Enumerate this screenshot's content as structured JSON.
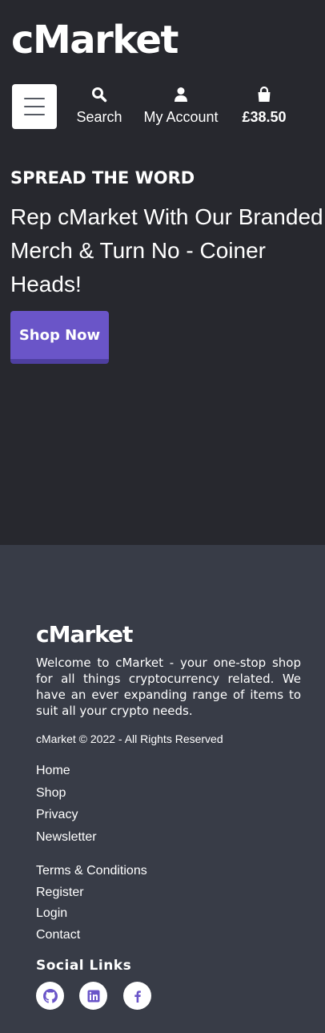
{
  "header": {
    "logo": "cMarket",
    "menu_icon": "hamburger-icon",
    "search": {
      "icon": "search-icon",
      "label": "Search"
    },
    "account": {
      "icon": "user-icon",
      "label": "My Account"
    },
    "bag": {
      "icon": "shopping-bag-icon",
      "total": "£38.50"
    }
  },
  "hero": {
    "eyebrow": "SPREAD THE WORD",
    "headline": "Rep cMarket With Our Branded Merch & Turn No - Coiner Heads!",
    "cta_label": "Shop Now"
  },
  "footer": {
    "logo": "cMarket",
    "description": "Welcome to cMarket - your one-stop shop for all things cryptocurrency related. We have an ever expanding range of items to suit all your crypto needs.",
    "copyright": "cMarket © 2022 - All Rights Reserved",
    "links_primary": [
      "Home",
      "Shop",
      "Privacy",
      "Newsletter"
    ],
    "links_secondary": [
      "Terms & Conditions",
      "Register",
      "Login",
      "Contact"
    ],
    "social_title": "Social Links",
    "social_icons": [
      "github-icon",
      "linkedin-icon",
      "facebook-icon"
    ]
  },
  "colors": {
    "hero_bg": "#27282e",
    "footer_bg": "#383c47",
    "accent": "#6a55c8"
  }
}
